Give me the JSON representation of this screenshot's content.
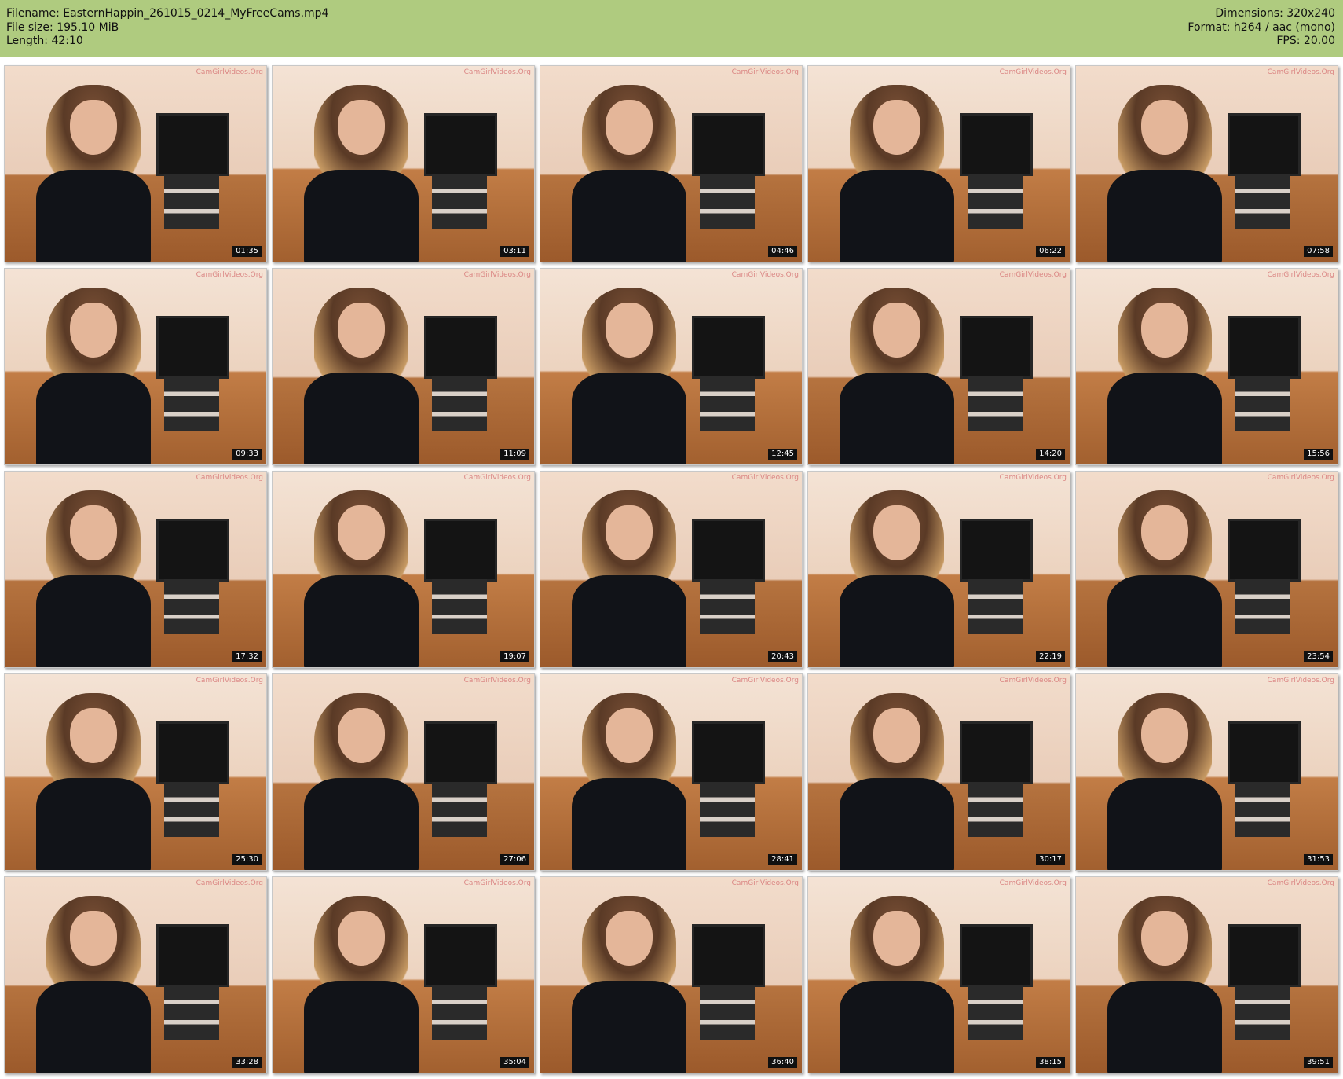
{
  "header": {
    "left": [
      "Filename: EasternHappin_261015_0214_MyFreeCams.mp4",
      "File size: 195.10 MiB",
      "Length: 42:10"
    ],
    "right": [
      "Dimensions: 320x240",
      "Format: h264 / aac (mono)",
      "FPS: 20.00"
    ]
  },
  "watermark": "CamGirlVideos.Org",
  "timestamps": [
    "01:35",
    "03:11",
    "04:46",
    "06:22",
    "07:58",
    "09:33",
    "11:09",
    "12:45",
    "14:20",
    "15:56",
    "17:32",
    "19:07",
    "20:43",
    "22:19",
    "23:54",
    "25:30",
    "27:06",
    "28:41",
    "30:17",
    "31:53",
    "33:28",
    "35:04",
    "36:40",
    "38:15",
    "39:51"
  ],
  "colors": {
    "header_bg": "#afcb7f",
    "timestamp_bg": "#101010"
  }
}
